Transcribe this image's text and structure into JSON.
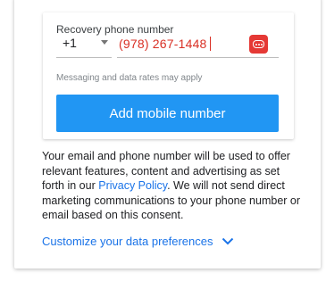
{
  "form": {
    "phone_label": "Recovery phone number",
    "country_code": "+1",
    "phone_value": "(978) 267-1448",
    "sms_note": "Messaging and data rates may apply",
    "add_button_label": "Add mobile number"
  },
  "consent": {
    "text_before_link": "Your email and phone number will be used to offer relevant features, content and advertising as set forth in our ",
    "privacy_link": "Privacy Policy",
    "text_after_link": ". We will not send direct marketing communications to your phone number or email based on this consent."
  },
  "customize": {
    "label": "Customize your data preferences",
    "icon": "chevron-down-icon"
  },
  "colors": {
    "accent": "#2196f3",
    "link": "#1a73e8",
    "error": "#d93025",
    "sms_icon_bg": "#e53935"
  }
}
